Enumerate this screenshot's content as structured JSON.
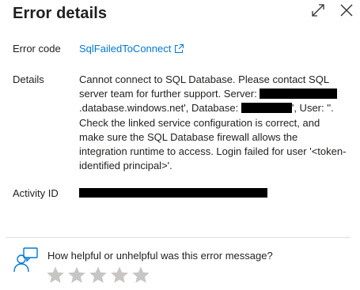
{
  "panel": {
    "title": "Error details"
  },
  "header_icons": {
    "expand": "expand-icon",
    "close": "close-icon"
  },
  "fields": {
    "error_code_label": "Error code",
    "error_code_value": "SqlFailedToConnect",
    "details_label": "Details",
    "details": {
      "part1": "Cannot connect to SQL Database. Please contact SQL server team for further support. Server: ",
      "part2": ".database.windows.net', Database: ",
      "part3": "', User: ''. Check the linked service configuration is correct, and make sure the SQL Database firewall allows the integration runtime to access. Login failed for user '<token-identified principal>'."
    },
    "activity_id_label": "Activity ID"
  },
  "feedback": {
    "question": "How helpful or unhelpful was this error message?",
    "rating_max": 5,
    "rating_value": 0
  },
  "colors": {
    "link": "#0078d4",
    "star_empty": "#c8c6c4",
    "divider": "#e1dfdd"
  }
}
